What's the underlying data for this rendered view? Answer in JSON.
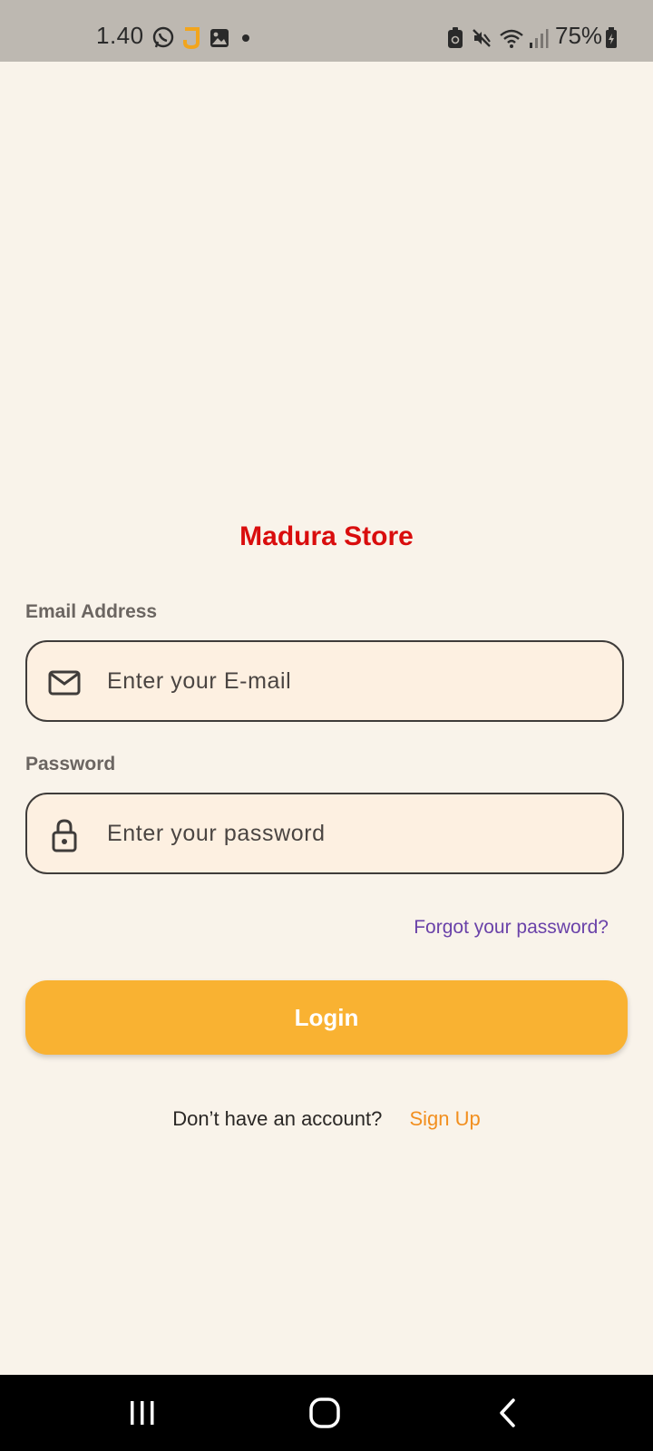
{
  "status_bar": {
    "time": "1.40",
    "battery_percent": "75%",
    "left_icons": [
      "whatsapp-icon",
      "app-notification-icon",
      "gallery-icon",
      "dot-icon"
    ],
    "right_icons": [
      "battery-saver-icon",
      "mute-icon",
      "wifi-icon",
      "signal-icon",
      "battery-icon"
    ]
  },
  "app": {
    "title": "Madura Store"
  },
  "form": {
    "email": {
      "label": "Email Address",
      "placeholder": "Enter your E-mail",
      "value": "",
      "icon": "mail-icon"
    },
    "password": {
      "label": "Password",
      "placeholder": "Enter your password",
      "value": "",
      "icon": "lock-icon"
    },
    "forgot_password": "Forgot your password?",
    "login_button": "Login",
    "signup_prompt": "Don’t have an account?",
    "signup_link": "Sign Up"
  },
  "nav_bar": {
    "buttons": [
      "recents-icon",
      "home-icon",
      "back-icon"
    ]
  },
  "colors": {
    "background": "#f9f3ea",
    "title": "#d90d0d",
    "accent": "#f9b232",
    "link": "#6a42a9",
    "signup": "#f28f1f",
    "input_fill": "#fdf0e1"
  }
}
